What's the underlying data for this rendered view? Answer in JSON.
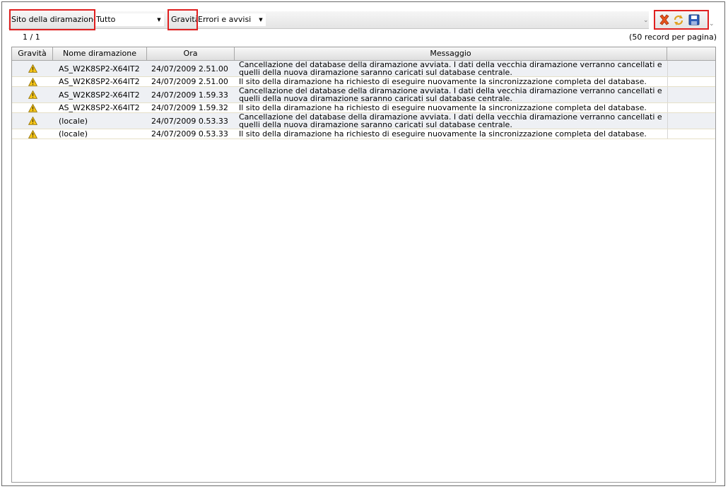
{
  "toolbar": {
    "site_label": "Sito della diramazione:",
    "site_value": "Tutto",
    "severity_label": "Gravità:",
    "severity_value": "Errori e avvisi"
  },
  "actions": {
    "delete_icon": "delete-x-icon",
    "refresh_icon": "refresh-icon",
    "save_icon": "save-floppy-icon"
  },
  "pager": {
    "page": "1 / 1",
    "per_page": "(50 record per pagina)"
  },
  "table": {
    "columns": [
      "Gravità",
      "Nome diramazione",
      "Ora",
      "Messaggio"
    ],
    "rows": [
      {
        "severity_icon": "warning-icon",
        "name": "AS_W2K8SP2-X64IT2",
        "time": "24/07/2009 2.51.00",
        "message": "Cancellazione del database della diramazione avviata. I dati della vecchia diramazione verranno cancellati e quelli della nuova diramazione saranno caricati sul database centrale."
      },
      {
        "severity_icon": "warning-icon",
        "name": "AS_W2K8SP2-X64IT2",
        "time": "24/07/2009 2.51.00",
        "message": "Il sito della diramazione ha richiesto di eseguire nuovamente la sincronizzazione completa del database."
      },
      {
        "severity_icon": "warning-icon",
        "name": "AS_W2K8SP2-X64IT2",
        "time": "24/07/2009 1.59.33",
        "message": "Cancellazione del database della diramazione avviata. I dati della vecchia diramazione verranno cancellati e quelli della nuova diramazione saranno caricati sul database centrale."
      },
      {
        "severity_icon": "warning-icon",
        "name": "AS_W2K8SP2-X64IT2",
        "time": "24/07/2009 1.59.32",
        "message": "Il sito della diramazione ha richiesto di eseguire nuovamente la sincronizzazione completa del database."
      },
      {
        "severity_icon": "warning-icon",
        "name": "(locale)",
        "time": "24/07/2009 0.53.33",
        "message": "Cancellazione del database della diramazione avviata. I dati della vecchia diramazione verranno cancellati e quelli della nuova diramazione saranno caricati sul database centrale."
      },
      {
        "severity_icon": "warning-icon",
        "name": "(locale)",
        "time": "24/07/2009 0.53.33",
        "message": "Il sito della diramazione ha richiesto di eseguire nuovamente la sincronizzazione completa del database."
      }
    ]
  },
  "colors": {
    "highlight_border": "#e02020",
    "warning_fill": "#f5c518",
    "row_alt": "#eef0f4"
  }
}
